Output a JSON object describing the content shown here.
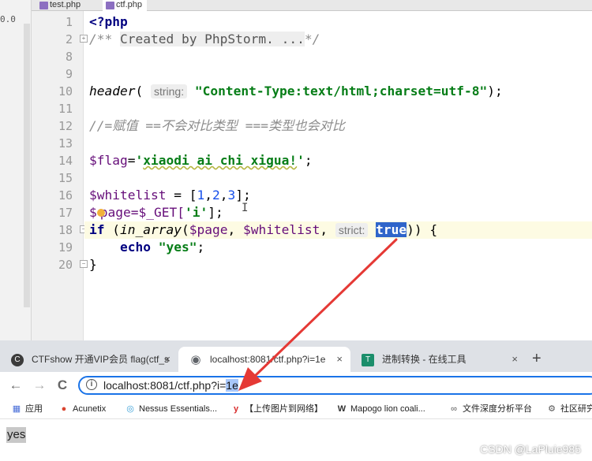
{
  "ide": {
    "strip_text": "0.0",
    "tabs": [
      {
        "label": "test.php",
        "active": false
      },
      {
        "label": "ctf.php",
        "active": true
      }
    ],
    "line_numbers": [
      "1",
      "2",
      "8",
      "9",
      "10",
      "11",
      "12",
      "13",
      "14",
      "15",
      "16",
      "17",
      "18",
      "19",
      "20"
    ],
    "code": {
      "l1": "<?php",
      "l2_a": "/** ",
      "l2_b": "Created by PhpStorm. ...",
      "l2_c": "*/",
      "l10_fn": "header",
      "l10_open": "(",
      "l10_hint": "string:",
      "l10_str": "\"Content-Type:text/html;charset=utf-8\"",
      "l10_close": ");",
      "l12": "//=赋值 ==不会对比类型 ===类型也会对比",
      "l14_var": "$flag",
      "l14_eq": "=",
      "l14_q1": "'",
      "l14_str": "xiaodi ai chi xigua!",
      "l14_q2": "'",
      "l14_end": ";",
      "l16_var": "$whitelist",
      "l16_a": " = [",
      "l16_n1": "1",
      "l16_c1": ",",
      "l16_n2": "2",
      "l16_c2": ",",
      "l16_n3": "3",
      "l16_b": "];",
      "l17_a": "$",
      "l17_b": "page",
      "l17_c": "=$_GET[",
      "l17_str": "'i'",
      "l17_d": "];",
      "l18_if": "if",
      "l18_a": " (",
      "l18_fn": "in_array",
      "l18_b": "(",
      "l18_v1": "$page",
      "l18_c": ", ",
      "l18_v2": "$whitelist",
      "l18_d": ", ",
      "l18_hint": "strict:",
      "l18_true": "true",
      "l18_e": ")) {",
      "l19_kw": "echo",
      "l19_str": "\"yes\"",
      "l19_end": ";",
      "l20": "}"
    },
    "caret_glyph": "I"
  },
  "browser": {
    "tabs": [
      {
        "label": "CTFshow 开通VIP会员 flag(ctf_s",
        "close": "×",
        "icon": "C",
        "icon_color": "#3b3b3b"
      },
      {
        "label": "localhost:8081/ctf.php?i=1e",
        "close": "×",
        "icon": "◉",
        "icon_color": "#5f6368"
      },
      {
        "label": "进制转换 - 在线工具",
        "close": "×",
        "icon": "T",
        "icon_color": "#1b8e6b"
      }
    ],
    "new_tab": "+",
    "nav": {
      "back": "←",
      "forward": "→",
      "reload": "C"
    },
    "url_prefix": "localhost:8081/ctf.php?i=",
    "url_selected": "1e",
    "bookmarks": [
      {
        "label": "应用",
        "icon": "▦",
        "color": "#4a6fd8"
      },
      {
        "label": "Acunetix",
        "icon": "●",
        "color": "#d9442f"
      },
      {
        "label": "Nessus Essentials...",
        "icon": "◎",
        "color": "#3aa0d8"
      },
      {
        "label": "【上传图片到网络】",
        "icon": "y",
        "color": "#d82d2d"
      },
      {
        "label": "Mapogo lion coali...",
        "icon": "W",
        "color": "#333333"
      },
      {
        "label": "文件深度分析平台",
        "icon": "∞",
        "color": "#555555"
      },
      {
        "label": "社区研究",
        "icon": "⚙",
        "color": "#555555"
      }
    ],
    "page_text": "yes"
  },
  "watermark": "CSDN @LaPluie985",
  "colors": {
    "arrow": "#e53935",
    "selection": "#2f65ca",
    "omnibox_border": "#1a73e8"
  }
}
